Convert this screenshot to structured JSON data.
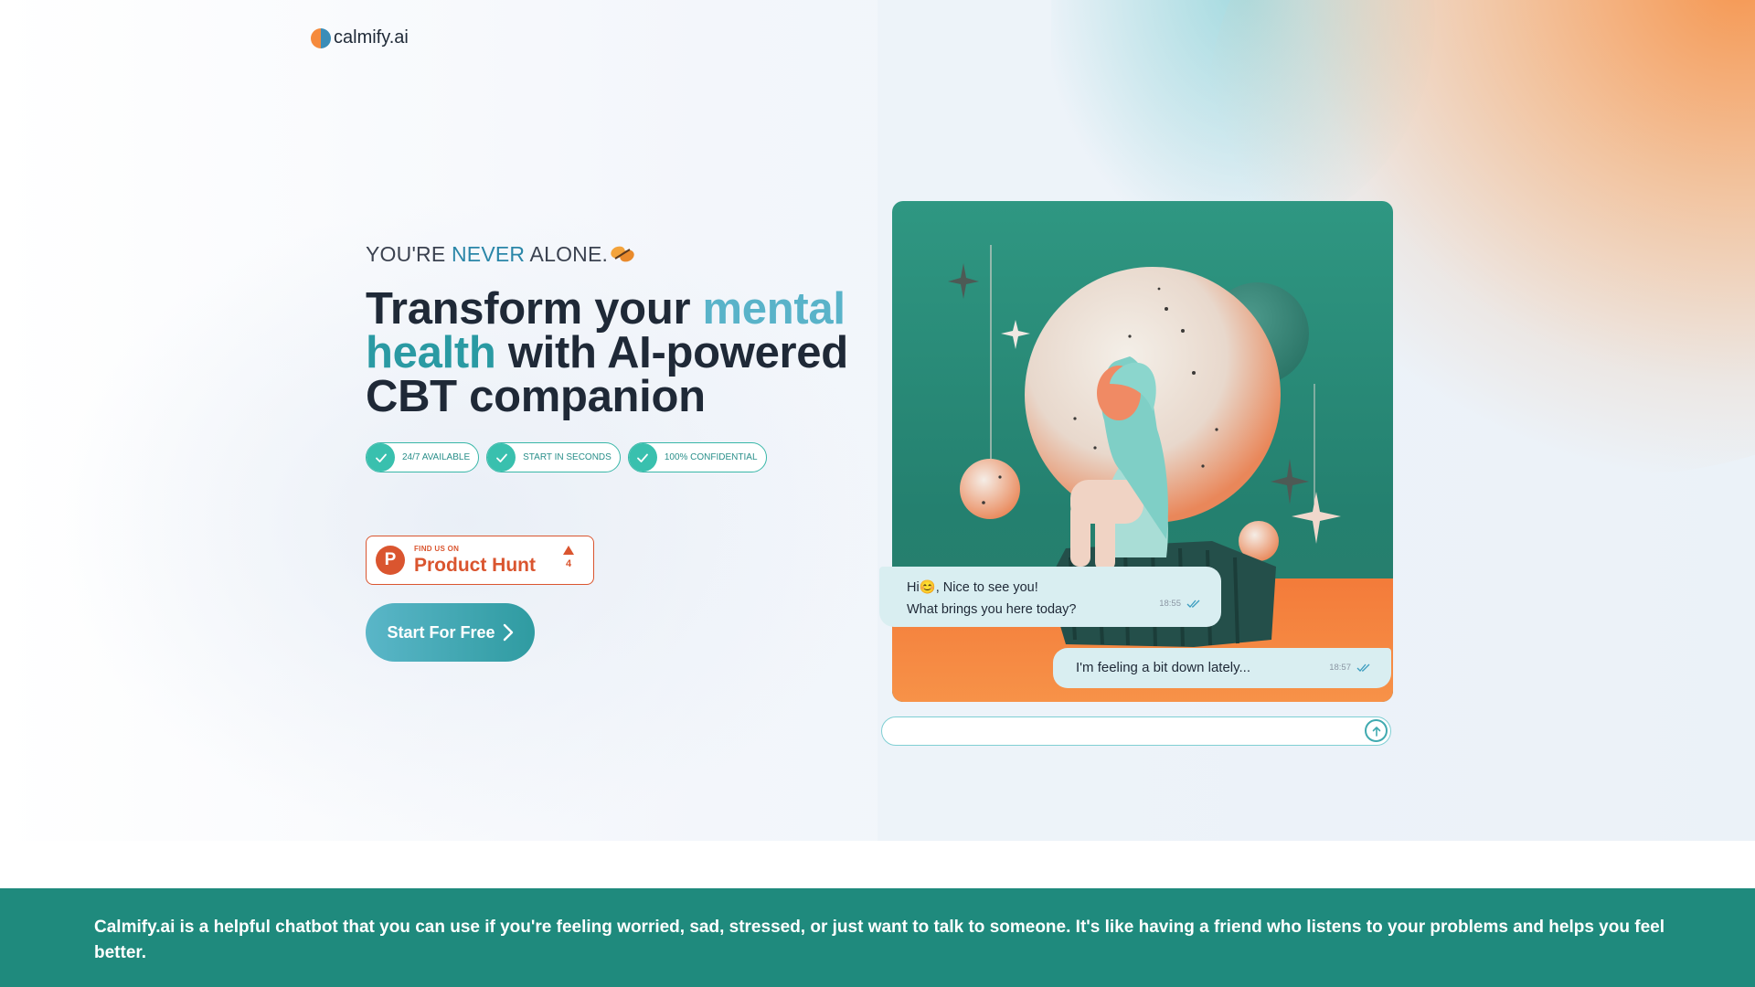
{
  "header": {
    "logo_text": "calmify.ai",
    "logo_icon": "calmify-logo-icon"
  },
  "hero": {
    "tagline": {
      "part1": "YOU'RE ",
      "accent": "NEVER",
      "part2": " ALONE.",
      "emoji_icon": "butterfly-icon"
    },
    "headline": {
      "part1": "Transform your ",
      "highlight1": "mental",
      "highlight2": "health",
      "part2": " with AI-powered CBT companion"
    },
    "badges": [
      {
        "label": "24/7 AVAILABLE",
        "icon": "check-icon"
      },
      {
        "label": "START IN SECONDS",
        "icon": "check-icon"
      },
      {
        "label": "100% CONFIDENTIAL",
        "icon": "check-icon"
      }
    ],
    "product_hunt": {
      "logo_letter": "P",
      "small_label": "FIND US ON",
      "big_label": "Product Hunt",
      "upvotes": "4"
    },
    "cta_label": "Start For Free"
  },
  "chat": {
    "bot_message_line1": "Hi😊, Nice to see you!",
    "bot_message_line2": "What brings you here today?",
    "bot_time": "18:55",
    "user_message": "I'm feeling a bit down lately...",
    "user_time": "18:57",
    "input_placeholder": "",
    "send_icon": "arrow-up-icon"
  },
  "banner": {
    "text": "Calmify.ai is a helpful chatbot that you can use if you're feeling worried, sad, stressed, or just want to talk to someone. It's like having a friend who listens to your problems and helps you feel better."
  },
  "colors": {
    "brand_teal": "#2a9aa3",
    "accent_blue": "#2a86a8",
    "product_hunt": "#da552f",
    "banner_bg": "#1f8a7d",
    "card_orange": "#f37b3a"
  }
}
